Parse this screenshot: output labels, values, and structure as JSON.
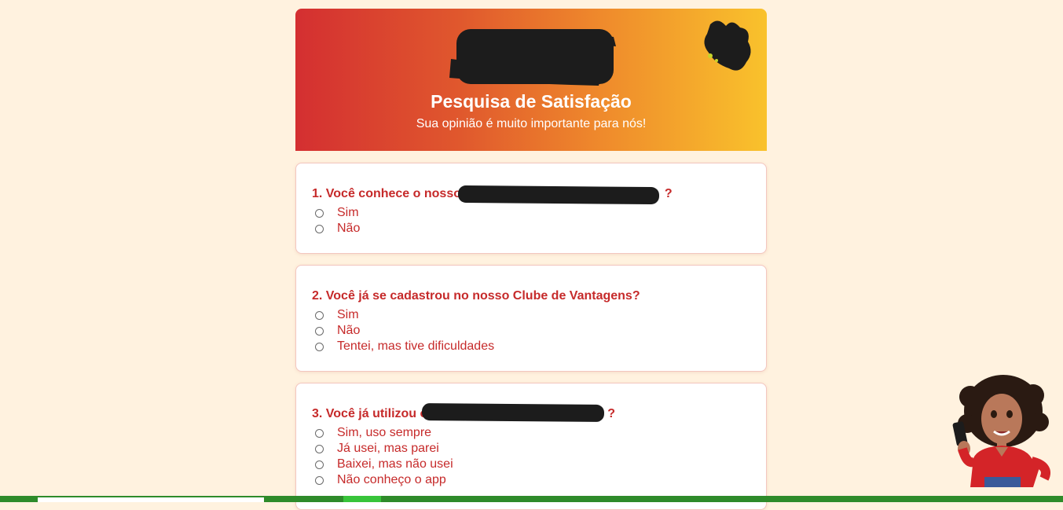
{
  "header": {
    "title": "Pesquisa de Satisfação",
    "subtitle": "Sua opinião é muito importante para nós!"
  },
  "questions": [
    {
      "label": "1. Você conhece o nosso",
      "label_end": "?",
      "options": [
        "Sim",
        "Não"
      ]
    },
    {
      "label": "2. Você já se cadastrou no nosso Clube de Vantagens?",
      "options": [
        "Sim",
        "Não",
        "Tentei, mas tive dificuldades"
      ]
    },
    {
      "label": "3. Você já utilizou o",
      "label_end": "?",
      "options": [
        "Sim, uso sempre",
        "Já usei, mas parei",
        "Baixei, mas não usei",
        "Não conheço o app"
      ]
    }
  ],
  "colors": {
    "question_text": "#c62a2a",
    "background": "#fff2df",
    "header_gradient_start": "#d42f31",
    "header_gradient_end": "#f9c22c",
    "bottom_bar": "#2e8b2a"
  }
}
